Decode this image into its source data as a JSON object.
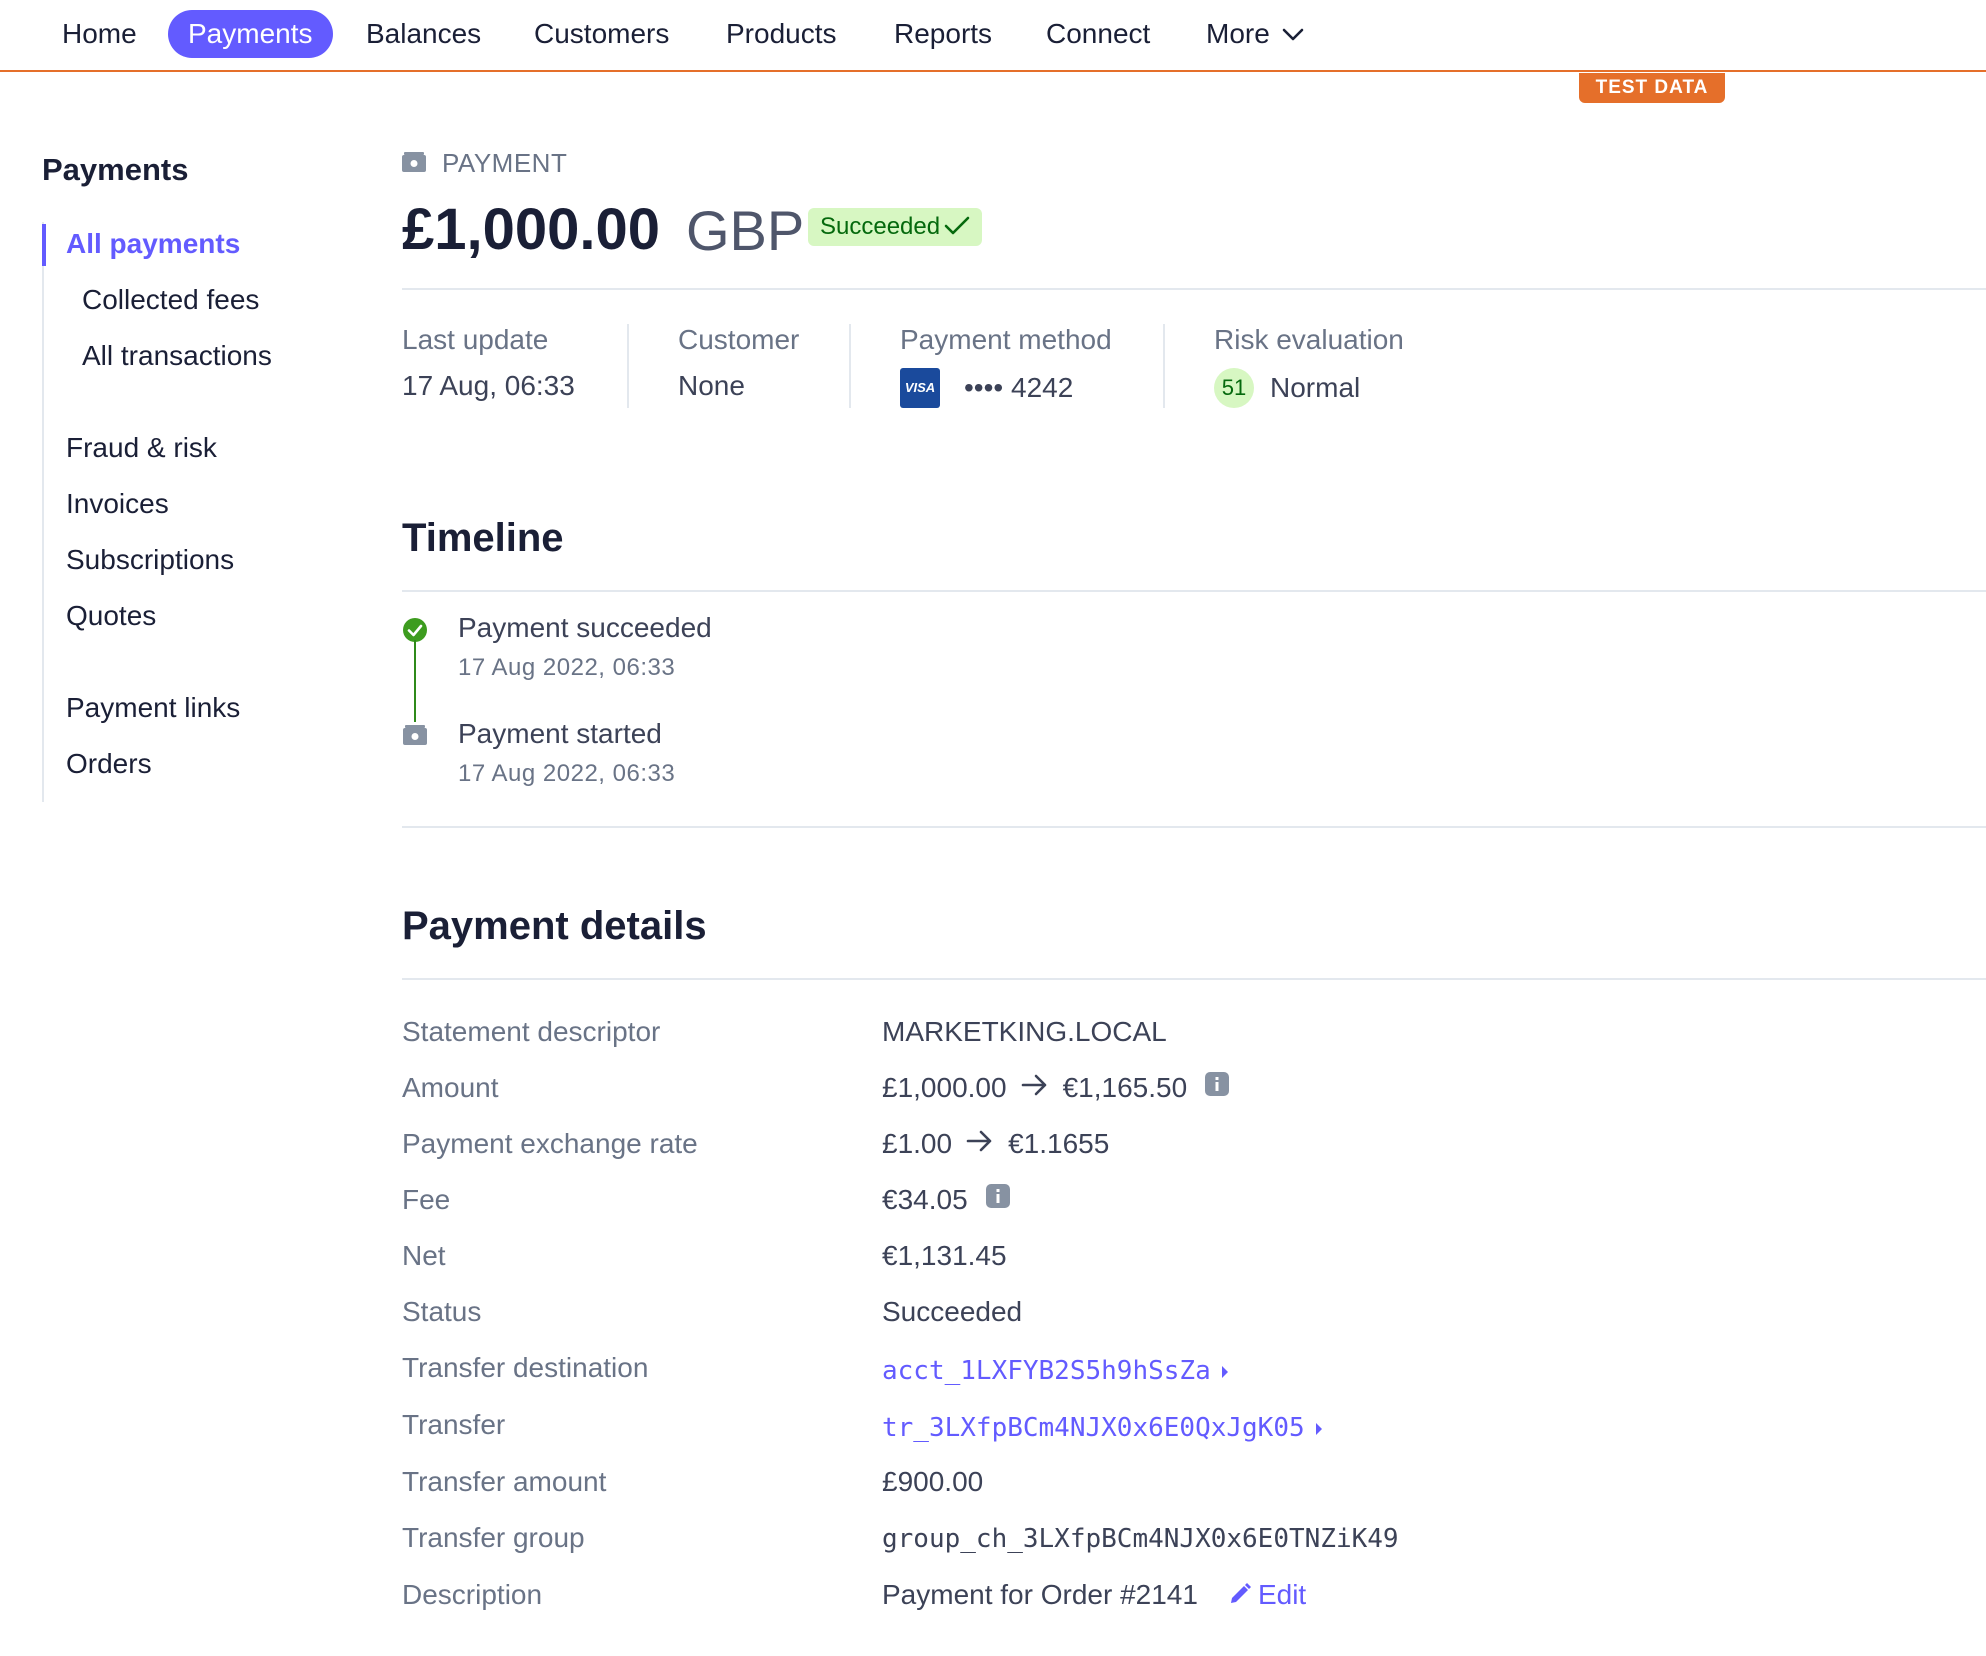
{
  "nav": {
    "items": [
      "Home",
      "Payments",
      "Balances",
      "Customers",
      "Products",
      "Reports",
      "Connect",
      "More"
    ],
    "active": "Payments",
    "test_badge": "TEST DATA"
  },
  "sidebar": {
    "title": "Payments",
    "items": [
      {
        "label": "All payments",
        "active": true
      },
      {
        "label": "Collected fees"
      },
      {
        "label": "All transactions"
      },
      {
        "label": "Fraud & risk"
      },
      {
        "label": "Invoices"
      },
      {
        "label": "Subscriptions"
      },
      {
        "label": "Quotes"
      },
      {
        "label": "Payment links"
      },
      {
        "label": "Orders"
      }
    ]
  },
  "header": {
    "type_label": "PAYMENT",
    "amount": "£1,000.00",
    "currency": "GBP",
    "status": "Succeeded"
  },
  "summary": {
    "last_update_label": "Last update",
    "last_update": "17 Aug, 06:33",
    "customer_label": "Customer",
    "customer": "None",
    "payment_method_label": "Payment method",
    "card_brand": "VISA",
    "card_last4": "•••• 4242",
    "risk_label": "Risk evaluation",
    "risk_score": "51",
    "risk_level": "Normal"
  },
  "timeline": {
    "title": "Timeline",
    "events": [
      {
        "title": "Payment succeeded",
        "date": "17 Aug 2022, 06:33"
      },
      {
        "title": "Payment started",
        "date": "17 Aug 2022, 06:33"
      }
    ]
  },
  "details": {
    "title": "Payment details",
    "statement_descriptor": {
      "label": "Statement descriptor",
      "value": "MARKETKING.LOCAL"
    },
    "amount": {
      "label": "Amount",
      "from": "£1,000.00",
      "to": "€1,165.50"
    },
    "exchange_rate": {
      "label": "Payment exchange rate",
      "from": "£1.00",
      "to": "€1.1655"
    },
    "fee": {
      "label": "Fee",
      "value": "€34.05"
    },
    "net": {
      "label": "Net",
      "value": "€1,131.45"
    },
    "status": {
      "label": "Status",
      "value": "Succeeded"
    },
    "transfer_destination": {
      "label": "Transfer destination",
      "value": "acct_1LXFYB2S5h9hSsZa"
    },
    "transfer": {
      "label": "Transfer",
      "value": "tr_3LXfpBCm4NJX0x6E0QxJgK05"
    },
    "transfer_amount": {
      "label": "Transfer amount",
      "value": "£900.00"
    },
    "transfer_group": {
      "label": "Transfer group",
      "value": "group_ch_3LXfpBCm4NJX0x6E0TNZiK49"
    },
    "description": {
      "label": "Description",
      "value": "Payment for Order #2141",
      "edit": "Edit"
    }
  },
  "colors": {
    "accent": "#635bff",
    "test_orange": "#e56f2a",
    "success_bg": "#d7f7c2",
    "success_text": "#05690d"
  }
}
